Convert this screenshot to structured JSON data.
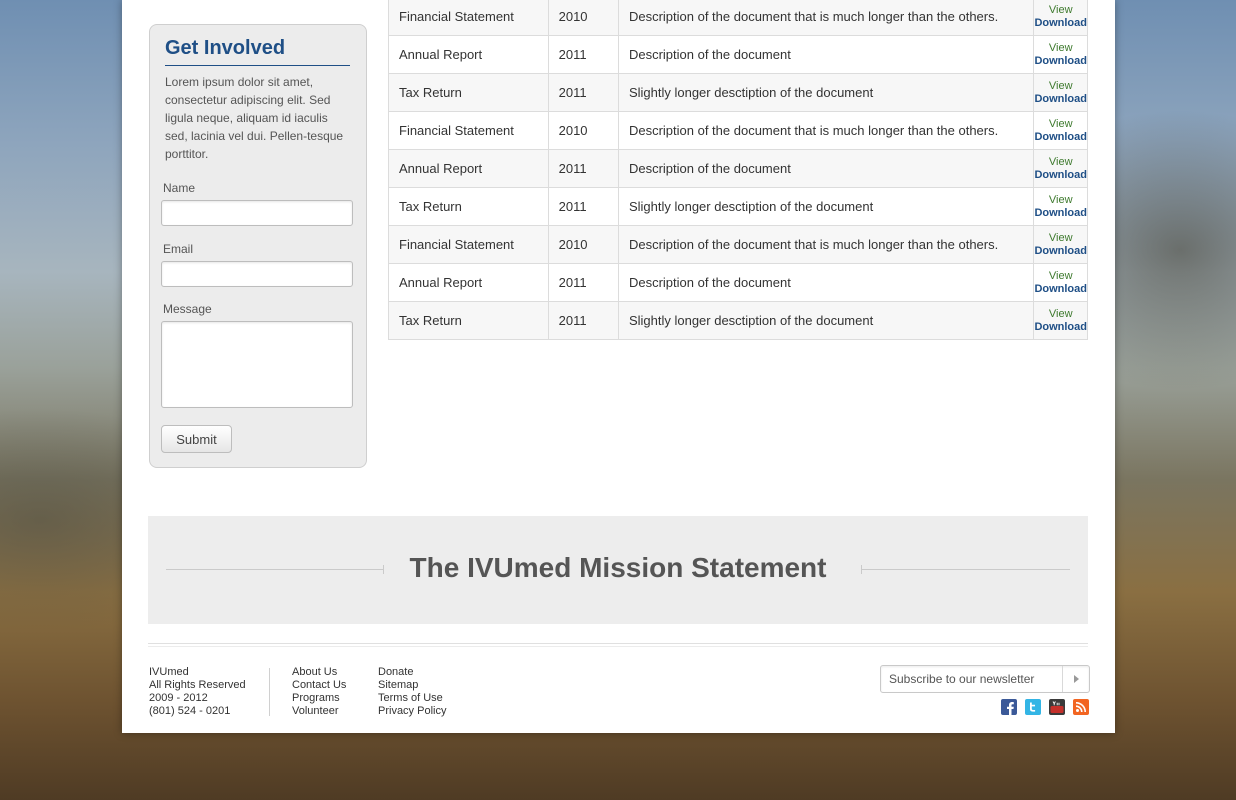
{
  "sidebar": {
    "title": "Get Involved",
    "text": "Lorem ipsum dolor sit amet, consectetur adipiscing elit. Sed ligula neque, aliquam id iaculis sed, lacinia vel dui. Pellen-tesque porttitor.",
    "name_label": "Name",
    "email_label": "Email",
    "message_label": "Message",
    "submit_label": "Submit"
  },
  "documents": {
    "rows": [
      {
        "type": "Financial Statement",
        "year": "2010",
        "description": "Description of the document that is much longer than the others.",
        "view": "View",
        "download": "Download"
      },
      {
        "type": "Annual Report",
        "year": "2011",
        "description": "Description of the document",
        "view": "View",
        "download": "Download"
      },
      {
        "type": "Tax Return",
        "year": "2011",
        "description": "Slightly longer desctiption of the document",
        "view": "View",
        "download": "Download"
      },
      {
        "type": "Financial Statement",
        "year": "2010",
        "description": "Description of the document that is much longer than the others.",
        "view": "View",
        "download": "Download"
      },
      {
        "type": "Annual Report",
        "year": "2011",
        "description": "Description of the document",
        "view": "View",
        "download": "Download"
      },
      {
        "type": "Tax Return",
        "year": "2011",
        "description": "Slightly longer desctiption of the document",
        "view": "View",
        "download": "Download"
      },
      {
        "type": "Financial Statement",
        "year": "2010",
        "description": "Description of the document that is much longer than the others.",
        "view": "View",
        "download": "Download"
      },
      {
        "type": "Annual Report",
        "year": "2011",
        "description": "Description of the document",
        "view": "View",
        "download": "Download"
      },
      {
        "type": "Tax Return",
        "year": "2011",
        "description": "Slightly longer desctiption of the document",
        "view": "View",
        "download": "Download"
      }
    ]
  },
  "mission": {
    "title": "The IVUmed Mission Statement"
  },
  "footer": {
    "org": [
      "IVUmed",
      "All Rights Reserved",
      "2009 - 2012",
      "(801) 524 - 0201"
    ],
    "links1": [
      "About Us",
      "Contact Us",
      "Programs",
      "Volunteer"
    ],
    "links2": [
      "Donate",
      "Sitemap",
      "Terms of Use",
      "Privacy Policy"
    ],
    "newsletter_placeholder": "Subscribe to our newsletter",
    "social_icons": [
      "facebook-icon",
      "twitter-icon",
      "youtube-icon",
      "rss-icon"
    ]
  },
  "colors": {
    "heading_blue": "#1f4f86",
    "view_green": "#3e7a2e",
    "facebook": "#3b5998",
    "twitter": "#33b5e5",
    "youtube": "#c4302b",
    "rss": "#f26522"
  }
}
